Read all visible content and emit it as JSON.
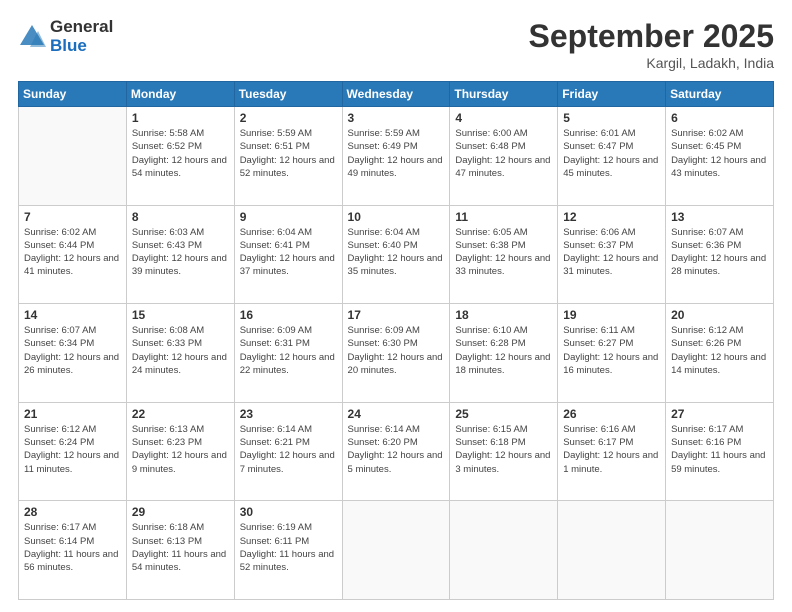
{
  "logo": {
    "general": "General",
    "blue": "Blue"
  },
  "header": {
    "month": "September 2025",
    "location": "Kargil, Ladakh, India"
  },
  "days_of_week": [
    "Sunday",
    "Monday",
    "Tuesday",
    "Wednesday",
    "Thursday",
    "Friday",
    "Saturday"
  ],
  "weeks": [
    [
      {
        "day": "",
        "sunrise": "",
        "sunset": "",
        "daylight": ""
      },
      {
        "day": "1",
        "sunrise": "Sunrise: 5:58 AM",
        "sunset": "Sunset: 6:52 PM",
        "daylight": "Daylight: 12 hours and 54 minutes."
      },
      {
        "day": "2",
        "sunrise": "Sunrise: 5:59 AM",
        "sunset": "Sunset: 6:51 PM",
        "daylight": "Daylight: 12 hours and 52 minutes."
      },
      {
        "day": "3",
        "sunrise": "Sunrise: 5:59 AM",
        "sunset": "Sunset: 6:49 PM",
        "daylight": "Daylight: 12 hours and 49 minutes."
      },
      {
        "day": "4",
        "sunrise": "Sunrise: 6:00 AM",
        "sunset": "Sunset: 6:48 PM",
        "daylight": "Daylight: 12 hours and 47 minutes."
      },
      {
        "day": "5",
        "sunrise": "Sunrise: 6:01 AM",
        "sunset": "Sunset: 6:47 PM",
        "daylight": "Daylight: 12 hours and 45 minutes."
      },
      {
        "day": "6",
        "sunrise": "Sunrise: 6:02 AM",
        "sunset": "Sunset: 6:45 PM",
        "daylight": "Daylight: 12 hours and 43 minutes."
      }
    ],
    [
      {
        "day": "7",
        "sunrise": "Sunrise: 6:02 AM",
        "sunset": "Sunset: 6:44 PM",
        "daylight": "Daylight: 12 hours and 41 minutes."
      },
      {
        "day": "8",
        "sunrise": "Sunrise: 6:03 AM",
        "sunset": "Sunset: 6:43 PM",
        "daylight": "Daylight: 12 hours and 39 minutes."
      },
      {
        "day": "9",
        "sunrise": "Sunrise: 6:04 AM",
        "sunset": "Sunset: 6:41 PM",
        "daylight": "Daylight: 12 hours and 37 minutes."
      },
      {
        "day": "10",
        "sunrise": "Sunrise: 6:04 AM",
        "sunset": "Sunset: 6:40 PM",
        "daylight": "Daylight: 12 hours and 35 minutes."
      },
      {
        "day": "11",
        "sunrise": "Sunrise: 6:05 AM",
        "sunset": "Sunset: 6:38 PM",
        "daylight": "Daylight: 12 hours and 33 minutes."
      },
      {
        "day": "12",
        "sunrise": "Sunrise: 6:06 AM",
        "sunset": "Sunset: 6:37 PM",
        "daylight": "Daylight: 12 hours and 31 minutes."
      },
      {
        "day": "13",
        "sunrise": "Sunrise: 6:07 AM",
        "sunset": "Sunset: 6:36 PM",
        "daylight": "Daylight: 12 hours and 28 minutes."
      }
    ],
    [
      {
        "day": "14",
        "sunrise": "Sunrise: 6:07 AM",
        "sunset": "Sunset: 6:34 PM",
        "daylight": "Daylight: 12 hours and 26 minutes."
      },
      {
        "day": "15",
        "sunrise": "Sunrise: 6:08 AM",
        "sunset": "Sunset: 6:33 PM",
        "daylight": "Daylight: 12 hours and 24 minutes."
      },
      {
        "day": "16",
        "sunrise": "Sunrise: 6:09 AM",
        "sunset": "Sunset: 6:31 PM",
        "daylight": "Daylight: 12 hours and 22 minutes."
      },
      {
        "day": "17",
        "sunrise": "Sunrise: 6:09 AM",
        "sunset": "Sunset: 6:30 PM",
        "daylight": "Daylight: 12 hours and 20 minutes."
      },
      {
        "day": "18",
        "sunrise": "Sunrise: 6:10 AM",
        "sunset": "Sunset: 6:28 PM",
        "daylight": "Daylight: 12 hours and 18 minutes."
      },
      {
        "day": "19",
        "sunrise": "Sunrise: 6:11 AM",
        "sunset": "Sunset: 6:27 PM",
        "daylight": "Daylight: 12 hours and 16 minutes."
      },
      {
        "day": "20",
        "sunrise": "Sunrise: 6:12 AM",
        "sunset": "Sunset: 6:26 PM",
        "daylight": "Daylight: 12 hours and 14 minutes."
      }
    ],
    [
      {
        "day": "21",
        "sunrise": "Sunrise: 6:12 AM",
        "sunset": "Sunset: 6:24 PM",
        "daylight": "Daylight: 12 hours and 11 minutes."
      },
      {
        "day": "22",
        "sunrise": "Sunrise: 6:13 AM",
        "sunset": "Sunset: 6:23 PM",
        "daylight": "Daylight: 12 hours and 9 minutes."
      },
      {
        "day": "23",
        "sunrise": "Sunrise: 6:14 AM",
        "sunset": "Sunset: 6:21 PM",
        "daylight": "Daylight: 12 hours and 7 minutes."
      },
      {
        "day": "24",
        "sunrise": "Sunrise: 6:14 AM",
        "sunset": "Sunset: 6:20 PM",
        "daylight": "Daylight: 12 hours and 5 minutes."
      },
      {
        "day": "25",
        "sunrise": "Sunrise: 6:15 AM",
        "sunset": "Sunset: 6:18 PM",
        "daylight": "Daylight: 12 hours and 3 minutes."
      },
      {
        "day": "26",
        "sunrise": "Sunrise: 6:16 AM",
        "sunset": "Sunset: 6:17 PM",
        "daylight": "Daylight: 12 hours and 1 minute."
      },
      {
        "day": "27",
        "sunrise": "Sunrise: 6:17 AM",
        "sunset": "Sunset: 6:16 PM",
        "daylight": "Daylight: 11 hours and 59 minutes."
      }
    ],
    [
      {
        "day": "28",
        "sunrise": "Sunrise: 6:17 AM",
        "sunset": "Sunset: 6:14 PM",
        "daylight": "Daylight: 11 hours and 56 minutes."
      },
      {
        "day": "29",
        "sunrise": "Sunrise: 6:18 AM",
        "sunset": "Sunset: 6:13 PM",
        "daylight": "Daylight: 11 hours and 54 minutes."
      },
      {
        "day": "30",
        "sunrise": "Sunrise: 6:19 AM",
        "sunset": "Sunset: 6:11 PM",
        "daylight": "Daylight: 11 hours and 52 minutes."
      },
      {
        "day": "",
        "sunrise": "",
        "sunset": "",
        "daylight": ""
      },
      {
        "day": "",
        "sunrise": "",
        "sunset": "",
        "daylight": ""
      },
      {
        "day": "",
        "sunrise": "",
        "sunset": "",
        "daylight": ""
      },
      {
        "day": "",
        "sunrise": "",
        "sunset": "",
        "daylight": ""
      }
    ]
  ]
}
